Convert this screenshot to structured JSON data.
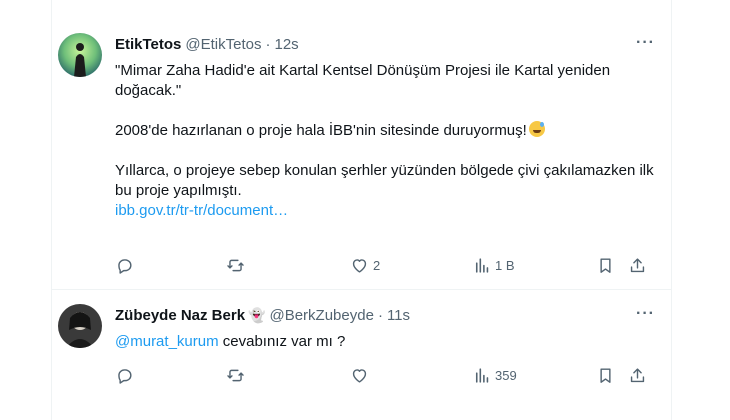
{
  "tweets": [
    {
      "name": "EtikTetos",
      "handle": "@EtikTetos",
      "separator": "·",
      "time": "12s",
      "paragraphs": [
        "\"Mimar Zaha Hadid'e ait Kartal Kentsel Dönüşüm Projesi ile Kartal yeniden doğacak.\"",
        "2008'de hazırlanan o proje hala İBB'nin sitesinde duruyormuş!",
        "Yıllarca, o projeye sebep konulan şerhler yüzünden bölgede çivi çakılamazken ilk bu proje yapılmıştı."
      ],
      "link": "ibb.gov.tr/tr-tr/document…",
      "emoji": "grinning-sweat-emoji",
      "counts": {
        "reply": "",
        "retweet": "",
        "like": "2",
        "views": "1 B"
      }
    },
    {
      "name": "Zübeyde Naz Berk",
      "name_emoji": "👻",
      "handle": "@BerkZubeyde",
      "separator": "·",
      "time": "11s",
      "mention": "@murat_kurum",
      "text": " cevabınız var mı ?",
      "counts": {
        "reply": "",
        "retweet": "",
        "like": "",
        "views": "359"
      }
    }
  ],
  "more_label": "···",
  "icons": [
    "reply-icon",
    "retweet-icon",
    "like-icon",
    "views-icon",
    "bookmark-icon",
    "share-icon"
  ],
  "colors": {
    "link": "#1d9bf0",
    "secondary": "#536471",
    "text": "#0f1419",
    "divider": "#eff3f4"
  }
}
